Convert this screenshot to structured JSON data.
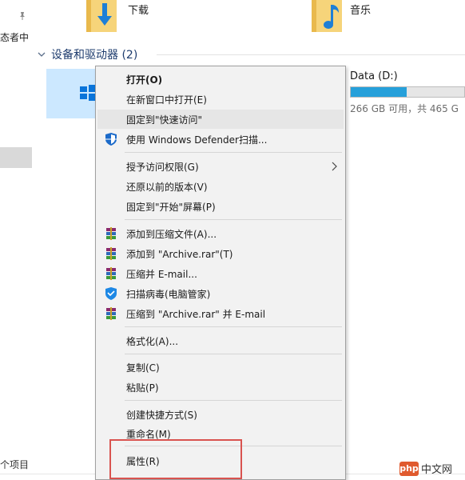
{
  "nav": {
    "label_partial": "态者中",
    "item_count_partial": "个项目"
  },
  "folders": [
    {
      "label": "下载",
      "icon": "download-folder-icon"
    },
    {
      "label": "音乐",
      "icon": "music-folder-icon"
    }
  ],
  "group": {
    "title": "设备和驱动器 (2)"
  },
  "drives": {
    "d": {
      "name": "Data (D:)",
      "used_fraction": 0.49,
      "free_text": "266 GB 可用，共 465 G"
    }
  },
  "menu": {
    "items": [
      {
        "label": "打开(O)"
      },
      {
        "label": "在新窗口中打开(E)"
      },
      {
        "label": "固定到\"快速访问\""
      },
      {
        "label": "使用 Windows Defender扫描..."
      },
      {
        "label": "授予访问权限(G)"
      },
      {
        "label": "还原以前的版本(V)"
      },
      {
        "label": "固定到\"开始\"屏幕(P)"
      },
      {
        "label": "添加到压缩文件(A)..."
      },
      {
        "label": "添加到 \"Archive.rar\"(T)"
      },
      {
        "label": "压缩并 E-mail..."
      },
      {
        "label": "扫描病毒(电脑管家)"
      },
      {
        "label": "压缩到 \"Archive.rar\" 并 E-mail"
      },
      {
        "label": "格式化(A)..."
      },
      {
        "label": "复制(C)"
      },
      {
        "label": "粘贴(P)"
      },
      {
        "label": "创建快捷方式(S)"
      },
      {
        "label": "重命名(M)"
      },
      {
        "label": "属性(R)"
      }
    ]
  },
  "watermark": {
    "logo": "php",
    "text": "中文网"
  },
  "colors": {
    "accent": "#26a0da",
    "selection": "#cce8ff",
    "highlight_box": "#d9534f"
  }
}
